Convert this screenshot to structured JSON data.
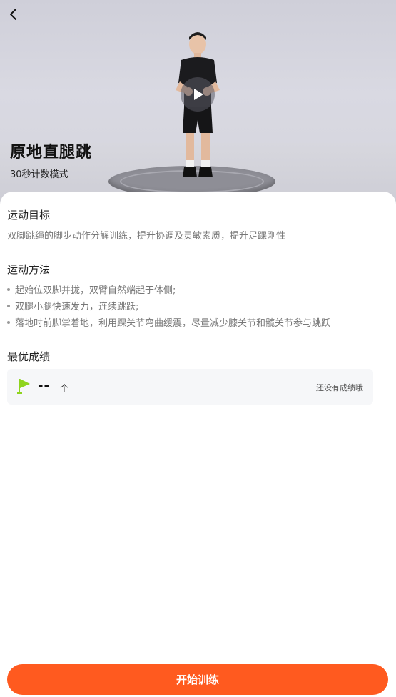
{
  "hero": {
    "title": "原地直腿跳",
    "subtitle": "30秒计数模式",
    "back_icon": "chevron-left-icon",
    "play_icon": "play-icon"
  },
  "goal": {
    "title": "运动目标",
    "text": "双脚跳绳的脚步动作分解训练，提升协调及灵敏素质，提升足踝刚性"
  },
  "method": {
    "title": "运动方法",
    "steps": [
      "起始位双脚并拢，双臂自然端起于体侧;",
      "双腿小腿快速发力，连续跳跃;",
      "落地时前脚掌着地，利用踝关节弯曲缓震，尽量减少膝关节和髋关节参与跳跃"
    ]
  },
  "best": {
    "title": "最优成绩",
    "value": "--",
    "unit": "个",
    "empty_text": "还没有成绩哦",
    "flag_icon": "flag-icon",
    "flag_color": "#8fd41e"
  },
  "footer": {
    "start_label": "开始训练",
    "accent": "#ff5a1f"
  }
}
